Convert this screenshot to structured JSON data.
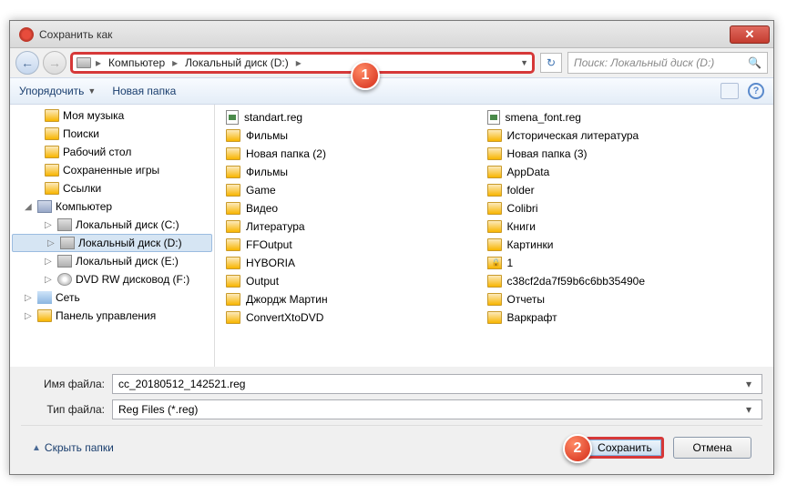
{
  "title": "Сохранить как",
  "breadcrumb": {
    "root": "Компьютер",
    "drive": "Локальный диск (D:)"
  },
  "search": {
    "placeholder": "Поиск: Локальный диск (D:)"
  },
  "toolbar": {
    "organize": "Упорядочить",
    "newfolder": "Новая папка"
  },
  "tree": {
    "music": "Моя музыка",
    "search": "Поиски",
    "desktop": "Рабочий стол",
    "savedgames": "Сохраненные игры",
    "links": "Ссылки",
    "computer": "Компьютер",
    "driveC": "Локальный диск (C:)",
    "driveD": "Локальный диск (D:)",
    "driveE": "Локальный диск (E:)",
    "dvd": "DVD RW дисковод (F:)",
    "network": "Сеть",
    "controlpanel": "Панель управления"
  },
  "filesL": [
    {
      "n": "standart.reg",
      "t": "reg"
    },
    {
      "n": "Фильмы",
      "t": "f"
    },
    {
      "n": "Новая папка (2)",
      "t": "f"
    },
    {
      "n": "Фильмы",
      "t": "f"
    },
    {
      "n": "Game",
      "t": "f"
    },
    {
      "n": "Видео",
      "t": "f"
    },
    {
      "n": "Литература",
      "t": "f"
    },
    {
      "n": "FFOutput",
      "t": "f"
    },
    {
      "n": "HYBORIA",
      "t": "f"
    },
    {
      "n": "Output",
      "t": "f"
    },
    {
      "n": "Джордж Мартин",
      "t": "f"
    },
    {
      "n": "ConvertXtoDVD",
      "t": "f"
    }
  ],
  "filesR": [
    {
      "n": "smena_font.reg",
      "t": "reg"
    },
    {
      "n": "Историческая литература",
      "t": "f"
    },
    {
      "n": "Новая папка (3)",
      "t": "f"
    },
    {
      "n": "AppData",
      "t": "f"
    },
    {
      "n": "folder",
      "t": "f"
    },
    {
      "n": "Colibri",
      "t": "f"
    },
    {
      "n": "Книги",
      "t": "f"
    },
    {
      "n": "Картинки",
      "t": "f"
    },
    {
      "n": "1",
      "t": "lock"
    },
    {
      "n": "c38cf2da7f59b6c6bb35490e",
      "t": "f"
    },
    {
      "n": "Отчеты",
      "t": "f"
    },
    {
      "n": "Варкрафт",
      "t": "f"
    }
  ],
  "filename": {
    "label": "Имя файла:",
    "value": "cc_20180512_142521.reg"
  },
  "filetype": {
    "label": "Тип файла:",
    "value": "Reg Files (*.reg)"
  },
  "hidefolders": "Скрыть папки",
  "save": "Сохранить",
  "cancel": "Отмена",
  "callout1": "1",
  "callout2": "2"
}
